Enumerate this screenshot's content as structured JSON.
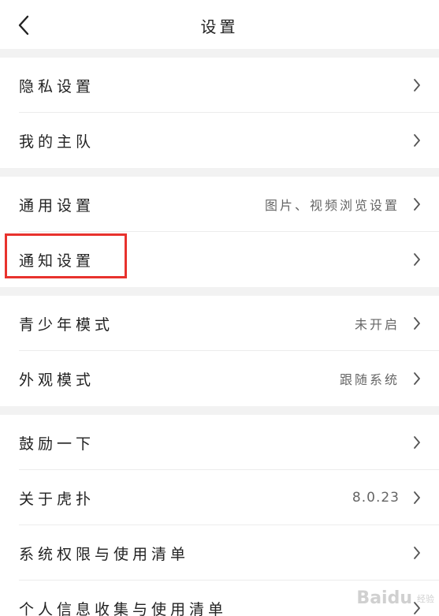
{
  "header": {
    "title": "设置",
    "back_icon": "chevron-left-icon"
  },
  "groups": [
    {
      "items": [
        {
          "label": "隐私设置",
          "value": ""
        },
        {
          "label": "我的主队",
          "value": ""
        }
      ]
    },
    {
      "items": [
        {
          "label": "通用设置",
          "value": "图片、视频浏览设置"
        },
        {
          "label": "通知设置",
          "value": ""
        }
      ]
    },
    {
      "items": [
        {
          "label": "青少年模式",
          "value": "未开启"
        },
        {
          "label": "外观模式",
          "value": "跟随系统"
        }
      ]
    },
    {
      "items": [
        {
          "label": "鼓励一下",
          "value": ""
        },
        {
          "label": "关于虎扑",
          "value": "8.0.23"
        },
        {
          "label": "系统权限与使用清单",
          "value": ""
        },
        {
          "label": "个人信息收集与使用清单",
          "value": ""
        }
      ]
    }
  ],
  "highlight": {
    "target": "通知设置",
    "color": "#e8322d"
  },
  "watermark": {
    "brand": "Baidu",
    "sub": "经验"
  },
  "colors": {
    "background": "#ffffff",
    "section_gap": "#f2f2f2",
    "text": "#222222",
    "secondary_text": "#666666"
  }
}
